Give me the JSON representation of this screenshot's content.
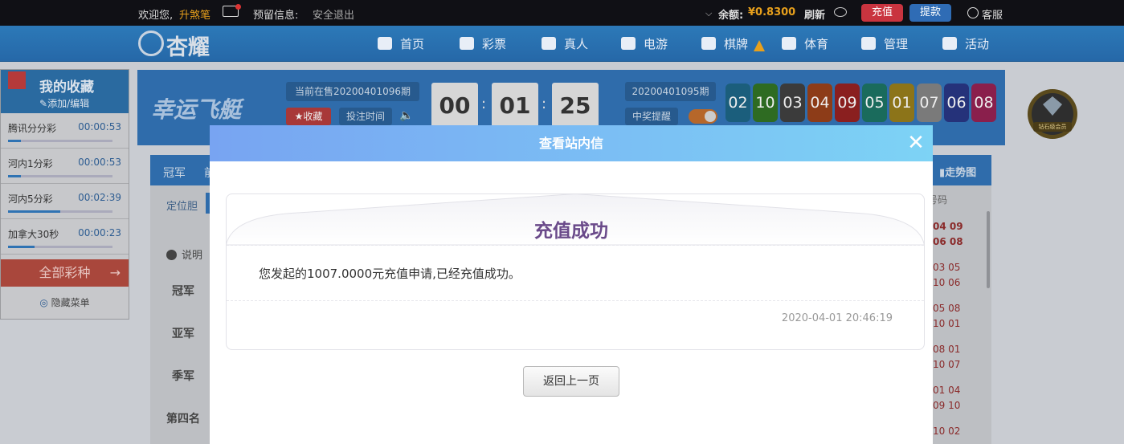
{
  "topbar": {
    "welcome": "欢迎您,",
    "username": "升煞笔",
    "reserved_info": "预留信息:",
    "logout": "安全退出",
    "balance_label": "余额:",
    "balance_value": "¥0.8300",
    "refresh": "刷新",
    "recharge": "充值",
    "withdraw": "提款",
    "service": "客服"
  },
  "brand": {
    "logo_text": "杏耀"
  },
  "nav": {
    "items": [
      {
        "label": "首页",
        "icon": "home-icon"
      },
      {
        "label": "彩票",
        "icon": "ticket-icon"
      },
      {
        "label": "真人",
        "icon": "dealer-icon"
      },
      {
        "label": "电游",
        "icon": "slot-icon"
      },
      {
        "label": "棋牌",
        "icon": "cards-icon"
      },
      {
        "label": "体育",
        "icon": "trophy-icon"
      },
      {
        "label": "管理",
        "icon": "users-icon"
      },
      {
        "label": "活动",
        "icon": "gift-icon"
      }
    ]
  },
  "favorites": {
    "title": "我的收藏",
    "edit": "添加/编辑",
    "items": [
      {
        "name": "腾讯分分彩",
        "time": "00:00:53",
        "progress": 0.12
      },
      {
        "name": "河内1分彩",
        "time": "00:00:53",
        "progress": 0.12
      },
      {
        "name": "河内5分彩",
        "time": "00:02:39",
        "progress": 0.5
      },
      {
        "name": "加拿大30秒",
        "time": "00:00:23",
        "progress": 0.25
      }
    ],
    "all_games": "全部彩种",
    "hide_menu": "隐藏菜单"
  },
  "game": {
    "title": "幸运飞艇",
    "current_issue": "当前在售20200401096期",
    "favorite": "收藏",
    "bet_time": "投注时间",
    "countdown": [
      "00",
      "01",
      "25"
    ],
    "last_issue": "20200401095期",
    "win_alert": "中奖提醒",
    "balls": [
      {
        "num": "02",
        "color": "#1b5e7c"
      },
      {
        "num": "10",
        "color": "#2e6b22"
      },
      {
        "num": "03",
        "color": "#3b3b3b"
      },
      {
        "num": "04",
        "color": "#8d3c18"
      },
      {
        "num": "09",
        "color": "#8a1f1f"
      },
      {
        "num": "05",
        "color": "#1a6b5c"
      },
      {
        "num": "01",
        "color": "#8c7419"
      },
      {
        "num": "07",
        "color": "#7a7a7a"
      },
      {
        "num": "06",
        "color": "#25327a"
      },
      {
        "num": "08",
        "color": "#8a1f4c"
      }
    ]
  },
  "content": {
    "tabs": [
      "冠军",
      "前"
    ],
    "sub": "定位胆",
    "info": "说明",
    "rows": [
      "冠军",
      "亚军",
      "季军",
      "第四名"
    ],
    "trend": "走势图",
    "code_header": "号码",
    "history": [
      [
        "04 09",
        "06 08"
      ],
      [
        "03 05",
        "10 06"
      ],
      [
        "05 08",
        "10 01"
      ],
      [
        "08 01",
        "10 07"
      ],
      [
        "01 04",
        "09 10"
      ],
      [
        "10 02",
        ""
      ]
    ]
  },
  "vip": {
    "label": "钻石级会员"
  },
  "modal": {
    "header": "查看站内信",
    "title": "充值成功",
    "body": "您发起的1007.0000元充值申请,已经充值成功。",
    "date": "2020-04-01 20:46:19",
    "back": "返回上一页"
  }
}
